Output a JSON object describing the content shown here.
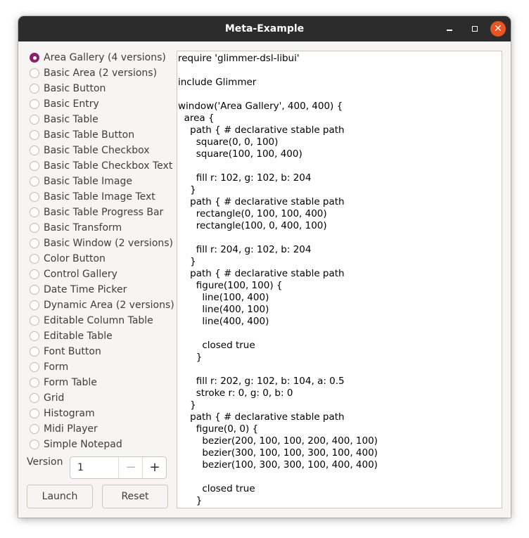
{
  "window": {
    "title": "Meta-Example",
    "controls": {
      "minimize_icon": "minimize-icon",
      "maximize_icon": "maximize-icon",
      "close_icon": "close-icon",
      "close_color": "#e95420"
    }
  },
  "examples": [
    {
      "label": "Area Gallery (4 versions)",
      "checked": true
    },
    {
      "label": "Basic Area (2 versions)",
      "checked": false
    },
    {
      "label": "Basic Button",
      "checked": false
    },
    {
      "label": "Basic Entry",
      "checked": false
    },
    {
      "label": "Basic Table",
      "checked": false
    },
    {
      "label": "Basic Table Button",
      "checked": false
    },
    {
      "label": "Basic Table Checkbox",
      "checked": false
    },
    {
      "label": "Basic Table Checkbox Text",
      "checked": false
    },
    {
      "label": "Basic Table Image",
      "checked": false
    },
    {
      "label": "Basic Table Image Text",
      "checked": false
    },
    {
      "label": "Basic Table Progress Bar",
      "checked": false
    },
    {
      "label": "Basic Transform",
      "checked": false
    },
    {
      "label": "Basic Window (2 versions)",
      "checked": false
    },
    {
      "label": "Color Button",
      "checked": false
    },
    {
      "label": "Control Gallery",
      "checked": false
    },
    {
      "label": "Date Time Picker",
      "checked": false
    },
    {
      "label": "Dynamic Area (2 versions)",
      "checked": false
    },
    {
      "label": "Editable Column Table",
      "checked": false
    },
    {
      "label": "Editable Table",
      "checked": false
    },
    {
      "label": "Font Button",
      "checked": false
    },
    {
      "label": "Form",
      "checked": false
    },
    {
      "label": "Form Table",
      "checked": false
    },
    {
      "label": "Grid",
      "checked": false
    },
    {
      "label": "Histogram",
      "checked": false
    },
    {
      "label": "Midi Player",
      "checked": false
    },
    {
      "label": "Simple Notepad",
      "checked": false
    }
  ],
  "version": {
    "label": "Version",
    "value": "1",
    "minus": "−",
    "plus": "+"
  },
  "buttons": {
    "launch": "Launch",
    "reset": "Reset"
  },
  "code_lines": [
    "require 'glimmer-dsl-libui'",
    "",
    "include Glimmer",
    "",
    "window('Area Gallery', 400, 400) {",
    "  area {",
    "    path { # declarative stable path",
    "      square(0, 0, 100)",
    "      square(100, 100, 400)",
    "",
    "      fill r: 102, g: 102, b: 204",
    "    }",
    "    path { # declarative stable path",
    "      rectangle(0, 100, 100, 400)",
    "      rectangle(100, 0, 400, 100)",
    "",
    "      fill r: 204, g: 102, b: 204",
    "    }",
    "    path { # declarative stable path",
    "      figure(100, 100) {",
    "        line(100, 400)",
    "        line(400, 100)",
    "        line(400, 400)",
    "",
    "        closed true",
    "      }",
    "",
    "      fill r: 202, g: 102, b: 104, a: 0.5",
    "      stroke r: 0, g: 0, b: 0",
    "    }",
    "    path { # declarative stable path",
    "      figure(0, 0) {",
    "        bezier(200, 100, 100, 200, 400, 100)",
    "        bezier(300, 100, 100, 300, 100, 400)",
    "        bezier(100, 300, 300, 100, 400, 400)",
    "",
    "        closed true",
    "      }"
  ]
}
